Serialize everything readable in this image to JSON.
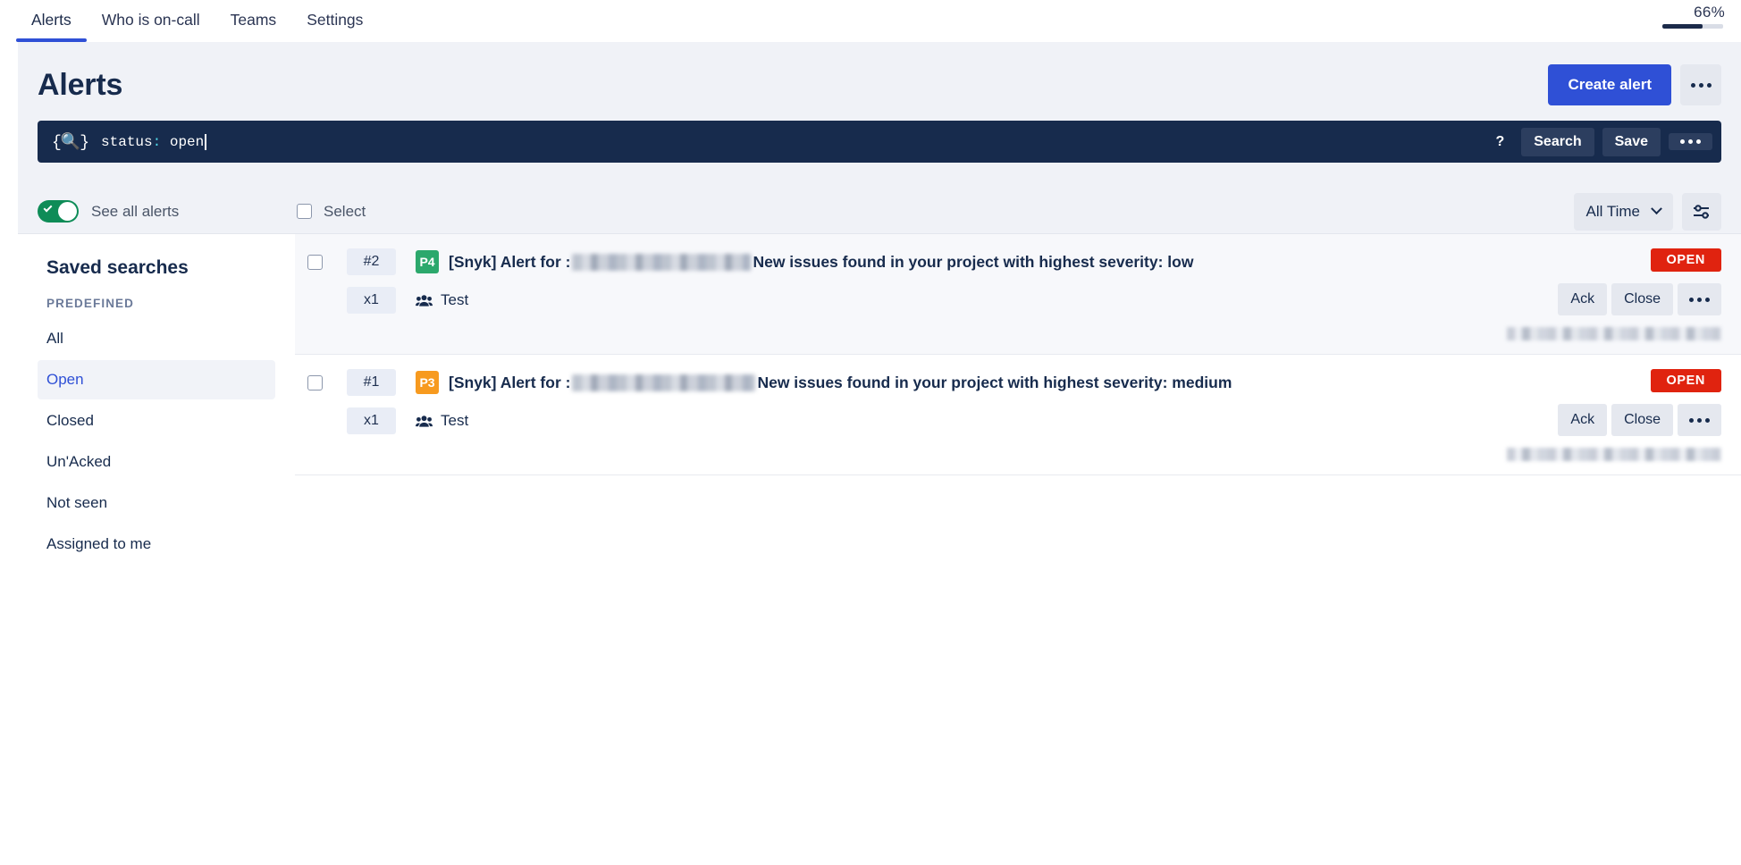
{
  "nav": {
    "tabs": [
      {
        "label": "Alerts",
        "active": true
      },
      {
        "label": "Who is on-call",
        "active": false
      },
      {
        "label": "Teams",
        "active": false
      },
      {
        "label": "Settings",
        "active": false
      }
    ]
  },
  "browser": {
    "zoom_label": "66%",
    "zoom_percent": 66
  },
  "header": {
    "title": "Alerts",
    "create_alert_label": "Create alert",
    "more_label": "more-options"
  },
  "query": {
    "icon": "query-braces-search-icon",
    "key": "status",
    "separator": ":",
    "value": "open",
    "full_text": "status: open",
    "help_label": "?",
    "search_label": "Search",
    "save_label": "Save",
    "more_label": "more-options"
  },
  "toolbar": {
    "toggle_label": "See all alerts",
    "toggle_on": true,
    "select_label": "Select",
    "select_checked": false,
    "time_filter": "All Time",
    "filter_icon": "sliders-icon"
  },
  "sidebar": {
    "title": "Saved searches",
    "section_label": "PREDEFINED",
    "items": [
      {
        "label": "All",
        "active": false
      },
      {
        "label": "Open",
        "active": true
      },
      {
        "label": "Closed",
        "active": false
      },
      {
        "label": "Un'Acked",
        "active": false
      },
      {
        "label": "Not seen",
        "active": false
      },
      {
        "label": "Assigned to me",
        "active": false
      }
    ]
  },
  "alerts": [
    {
      "id": "#2",
      "priority": "P4",
      "priority_color": "#2CA86C",
      "title_prefix": "[Snyk] Alert for :",
      "title_redacted": true,
      "title_suffix": "New issues found in your project with highest severity: low",
      "count": "x1",
      "team": "Test",
      "status": "OPEN",
      "status_color": "#E0230F",
      "ack_label": "Ack",
      "close_label": "Close",
      "more_label": "more-options",
      "timestamp_redacted": true,
      "shaded": true
    },
    {
      "id": "#1",
      "priority": "P3",
      "priority_color": "#F79A1F",
      "title_prefix": "[Snyk] Alert for :",
      "title_redacted": true,
      "title_suffix": "New issues found in your project with highest severity: medium",
      "count": "x1",
      "team": "Test",
      "status": "OPEN",
      "status_color": "#E0230F",
      "ack_label": "Ack",
      "close_label": "Close",
      "more_label": "more-options",
      "timestamp_redacted": true,
      "shaded": false
    }
  ]
}
